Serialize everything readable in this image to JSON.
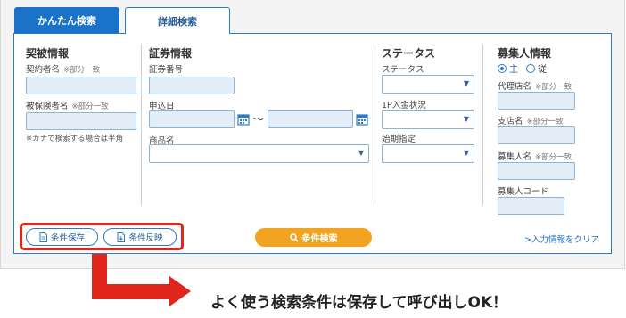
{
  "tabs": {
    "simple": "かんたん検索",
    "detail": "詳細検索"
  },
  "sections": {
    "contract": {
      "title": "契被情報",
      "contractor_label": "契約者名",
      "contractor_note": "※部分一致",
      "insured_label": "被保険者名",
      "insured_note": "※部分一致",
      "kana_hint": "※カナで検索する場合は半角"
    },
    "policy": {
      "title": "証券情報",
      "policy_number_label": "証券番号",
      "apply_date_label": "申込日",
      "range_separator": "〜",
      "product_label": "商品名"
    },
    "status": {
      "title": "ステータス",
      "status_label": "ステータス",
      "first_payment_label": "1P入金状況",
      "start_label": "始期指定"
    },
    "agent": {
      "title": "募集人情報",
      "radio_main": "主",
      "radio_sub": "従",
      "agency_label": "代理店名",
      "agency_note": "※部分一致",
      "branch_label": "支店名",
      "branch_note": "※部分一致",
      "recruiter_label": "募集人名",
      "recruiter_note": "※部分一致",
      "recruiter_code_label": "募集人コード"
    }
  },
  "buttons": {
    "save": "条件保存",
    "apply": "条件反映",
    "search": "条件検索",
    "clear": ">入力情報をクリア"
  },
  "callout": "よく使う検索条件は保存して呼び出しOK！",
  "colors": {
    "accent": "#1a73c8",
    "search": "#f2a31f",
    "highlight": "#e0261b"
  }
}
